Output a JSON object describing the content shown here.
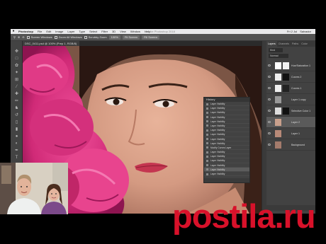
{
  "menubar": {
    "app_name": "Photoshop",
    "menus": [
      "File",
      "Edit",
      "Image",
      "Layer",
      "Type",
      "Select",
      "Filter",
      "3D",
      "View",
      "Window",
      "Help"
    ],
    "status_right": [
      "Fri 2 Jul",
      "Salvador"
    ]
  },
  "window_title": "Adobe Photoshop 2018",
  "options_bar": {
    "buttons": [
      "Screen Windows",
      "Zoom All Windows",
      "Scrubby Zoom",
      "Fit Screen",
      "Fill Screen"
    ],
    "zoom_value": "100%"
  },
  "document_tab": "DSC_0411.psd @ 100% (Prep 1, RGB/8)",
  "history_panel": {
    "title": "History",
    "items": [
      "Layer Visibility",
      "Layer Visibility",
      "Layer Visibility",
      "Layer Visibility",
      "Layer Visibility",
      "Layer Visibility",
      "Layer Visibility",
      "Layer Visibility",
      "Layer Visibility",
      "Layer Visibility",
      "Modify Curves Layer",
      "Layer Visibility",
      "Layer Visibility",
      "Layer Visibility",
      "Layer Visibility",
      "Layer Visibility",
      "Layer Visibility"
    ]
  },
  "panels": {
    "tabs": [
      "Layers",
      "Channels",
      "Paths",
      "Color"
    ],
    "kind_label": "Kind",
    "blend_mode": "Normal",
    "layers": [
      {
        "name": "Hue/Saturation 1",
        "thumb": "#ffffff",
        "mask": "#f2f2f2"
      },
      {
        "name": "Curves 2",
        "thumb": "#eeeeee",
        "mask": "#111111"
      },
      {
        "name": "Curves 1",
        "thumb": "#eeeeee",
        "mask": "#222222"
      },
      {
        "name": "Layer 1 copy",
        "thumb": "#999999",
        "mask": ""
      },
      {
        "name": "Selective Color 1",
        "thumb": "#dddddd",
        "mask": "#111111"
      },
      {
        "name": "Layer 2",
        "thumb": "#c9a08c",
        "mask": ""
      },
      {
        "name": "Layer 1",
        "thumb": "#b88a78",
        "mask": ""
      },
      {
        "name": "Background",
        "thumb": "#a47b6c",
        "mask": ""
      }
    ]
  },
  "watermark": "postila.ru",
  "colors": {
    "watermark": "#d8112a",
    "ui_dark": "#2b2b2b",
    "ui_panel": "#424242"
  }
}
